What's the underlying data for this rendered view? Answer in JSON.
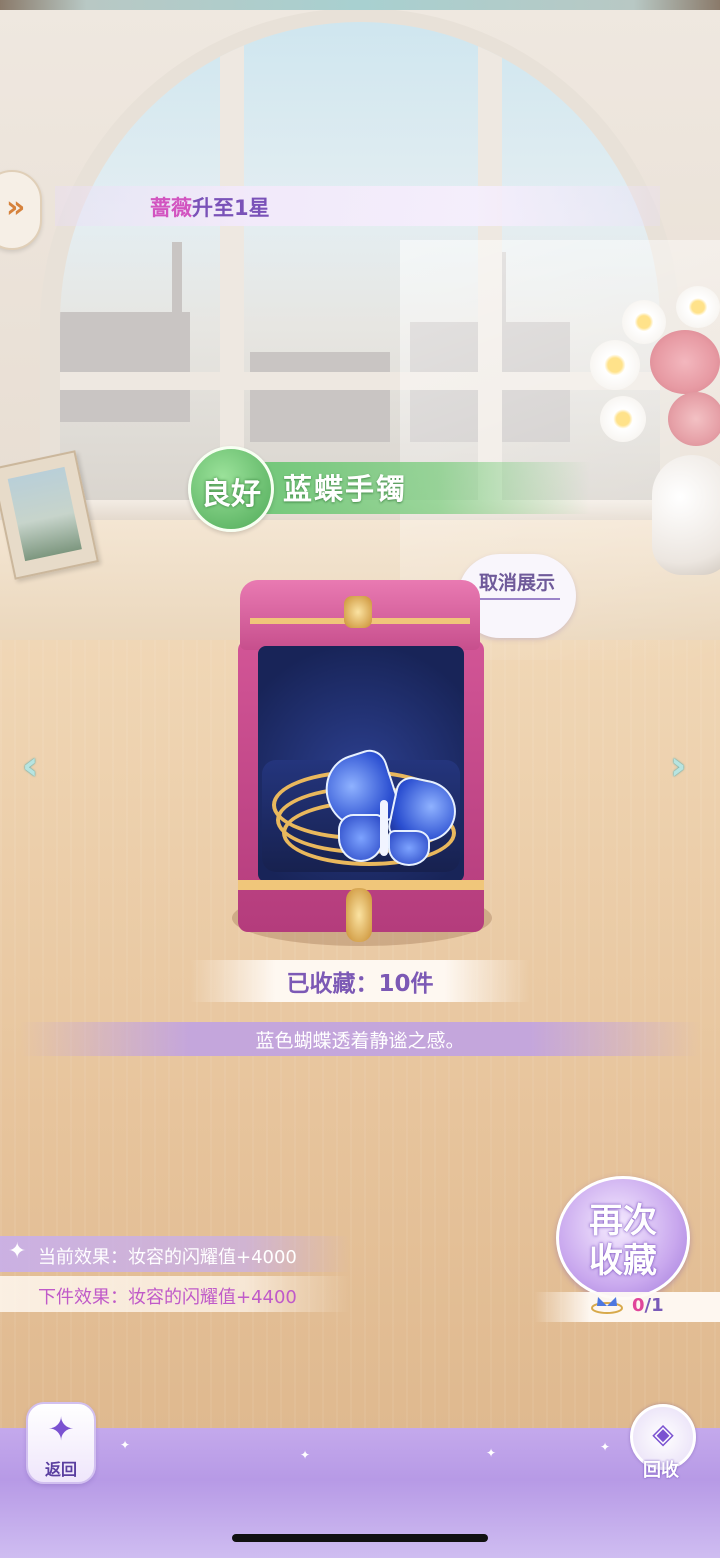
{
  "notification": {
    "name": "蔷薇",
    "text": "升至1星",
    "expand_icon": "»"
  },
  "item": {
    "grade_badge": "良好",
    "name": "蓝蝶手镯",
    "cancel_display": "取消展示",
    "collected": "已收藏：10件",
    "description": "蓝色蝴蝶透着静谧之感。"
  },
  "navigation": {
    "prev_icon": "‹",
    "next_icon": "›"
  },
  "effects": {
    "star_icon": "✦",
    "current": "当前效果：妆容的闪耀值+4000",
    "next": "下件效果：妆容的闪耀值+4400"
  },
  "collect_again": {
    "line1": "再次",
    "line2": "收藏",
    "cost_icon": "butterfly-bracelet-icon",
    "owned": "0",
    "required": "/1"
  },
  "bottom": {
    "back_label": "返回",
    "back_icon": "✦",
    "recycle_label": "回收",
    "recycle_icon": "◈"
  },
  "colors": {
    "accent_purple": "#7c59b5",
    "grade_green": "#4faa58",
    "box_pink": "#d25596",
    "bottom_bar": "#b79ae6"
  }
}
